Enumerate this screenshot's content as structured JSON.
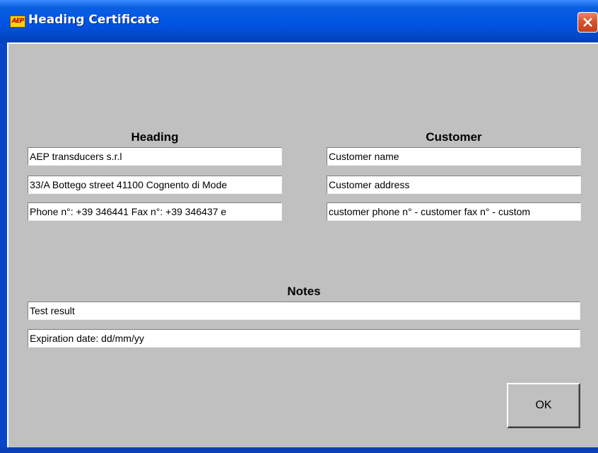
{
  "window": {
    "title": "Heading Certificate",
    "icon": "aep-logo-icon",
    "icon_text": "AEP",
    "close_icon": "close-icon"
  },
  "heading": {
    "title": "Heading",
    "lines": [
      "AEP transducers s.r.l",
      "33/A Bottego street 41100 Cognento di Mode",
      "Phone n°: +39 346441  Fax n°: +39 346437  e"
    ]
  },
  "customer": {
    "title": "Customer",
    "lines": [
      "Customer name",
      "Customer address",
      "customer phone n° - customer fax n° - custom"
    ]
  },
  "notes": {
    "title": "Notes",
    "lines": [
      "Test result",
      "Expiration date: dd/mm/yy"
    ]
  },
  "buttons": {
    "ok": "OK"
  },
  "colors": {
    "titlebar": "#0054e3",
    "client_background": "#c0c0c0",
    "close_button": "#d9532c"
  }
}
